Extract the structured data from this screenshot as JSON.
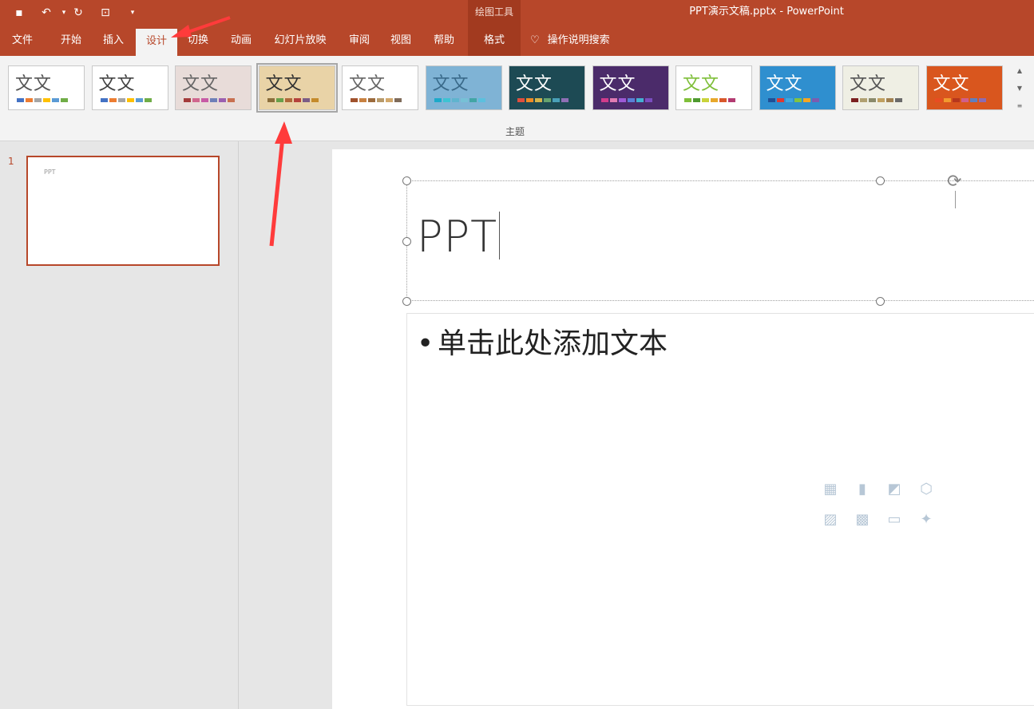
{
  "title_bar": {
    "window_title": "PPT演示文稿.pptx  -  PowerPoint",
    "context_group": "绘图工具",
    "quick_access": [
      "save-icon",
      "undo-icon",
      "redo-icon",
      "start-slideshow-icon",
      "customize-qat-icon"
    ]
  },
  "tabs": [
    {
      "label": "文件"
    },
    {
      "label": "开始"
    },
    {
      "label": "插入"
    },
    {
      "label": "设计"
    },
    {
      "label": "切换"
    },
    {
      "label": "动画"
    },
    {
      "label": "幻灯片放映"
    },
    {
      "label": "审阅"
    },
    {
      "label": "视图"
    },
    {
      "label": "帮助"
    },
    {
      "label": "格式"
    }
  ],
  "tell_me": {
    "label": "操作说明搜索",
    "icon": "lightbulb-icon"
  },
  "ribbon": {
    "group_label": "主题",
    "themes": [
      {
        "label": "文文",
        "bg": "#ffffff",
        "fg": "#555555",
        "swatches": [
          "#4472c4",
          "#ed7d31",
          "#a5a5a5",
          "#ffc000",
          "#5b9bd5",
          "#70ad47"
        ]
      },
      {
        "label": "文文",
        "bg": "#ffffff",
        "fg": "#444444",
        "swatches": [
          "#4472c4",
          "#ed7d31",
          "#a5a5a5",
          "#ffc000",
          "#5b9bd5",
          "#70ad47"
        ]
      },
      {
        "label": "文文",
        "bg": "#e8dcd9",
        "fg": "#666666",
        "swatches": [
          "#a33b3b",
          "#d0668e",
          "#c75aa5",
          "#6e7fb8",
          "#9b5fb0",
          "#c87050"
        ]
      },
      {
        "label": "文文",
        "bg": "#e9d3a7",
        "fg": "#333333",
        "swatches": [
          "#8b6e3b",
          "#68a04b",
          "#b0693a",
          "#b5423c",
          "#7b5d86",
          "#c48a2a"
        ]
      },
      {
        "label": "文文",
        "bg": "#ffffff",
        "fg": "#666666",
        "swatches": [
          "#a0522d",
          "#c88141",
          "#9c6b3d",
          "#b89a6a",
          "#d2a86b",
          "#7f6b5a"
        ]
      },
      {
        "label": "文文",
        "bg": "#7fb3d5",
        "fg": "#3a6a8a",
        "swatches": [
          "#1ca9c9",
          "#3dc3d3",
          "#5fb4ce",
          "#76c1d6",
          "#42a5a5",
          "#5bc0de"
        ]
      },
      {
        "label": "文文",
        "bg": "#1d4a54",
        "fg": "#ffffff",
        "swatches": [
          "#e04f3e",
          "#f08a24",
          "#d4b44a",
          "#64a36f",
          "#49a0b8",
          "#8e6fb5"
        ]
      },
      {
        "label": "文文",
        "bg": "#4b2b6a",
        "fg": "#ffffff",
        "swatches": [
          "#d13c8b",
          "#e07bb2",
          "#9d5ad6",
          "#5a7fd6",
          "#44b0d2",
          "#7a4dbf"
        ]
      },
      {
        "label": "文文",
        "bg": "#ffffff",
        "fg": "#7fbf3a",
        "swatches": [
          "#7fbf3a",
          "#4f9a2f",
          "#c9d33b",
          "#e8a82b",
          "#d9572b",
          "#b33b72"
        ]
      },
      {
        "label": "文文",
        "bg": "#2f8fcf",
        "fg": "#ffffff",
        "swatches": [
          "#1f4f96",
          "#e0382f",
          "#3fa7de",
          "#82c341",
          "#f5a623",
          "#7b5cb0"
        ]
      },
      {
        "label": "文文",
        "bg": "#efefe4",
        "fg": "#555555",
        "swatches": [
          "#7a1f1f",
          "#b0a070",
          "#8a8a6a",
          "#c0a060",
          "#a08050",
          "#6a6a6a"
        ]
      },
      {
        "label": "文文",
        "bg": "#d9561e",
        "fg": "#ffffff",
        "swatches": [
          "#e84c22",
          "#f29a2e",
          "#b6371d",
          "#d05f8b",
          "#5f7fbf",
          "#8d6bb3"
        ]
      }
    ],
    "scroll_buttons": [
      "scroll-up-icon",
      "scroll-down-icon",
      "more-icon"
    ]
  },
  "thumbnail": {
    "number": "1",
    "text": "PPT"
  },
  "slide": {
    "title": "PPT",
    "content_placeholder": "单击此处添加文本",
    "bullet": "•",
    "insert_icons": [
      "table-icon",
      "chart-icon",
      "smartart-icon",
      "3d-model-icon",
      "picture-icon",
      "online-picture-icon",
      "video-icon",
      "icons-icon"
    ]
  },
  "colors": {
    "accent": "#b7472a",
    "ribbon_bg": "#f3f3f3",
    "arrow": "#ff3b3b"
  }
}
